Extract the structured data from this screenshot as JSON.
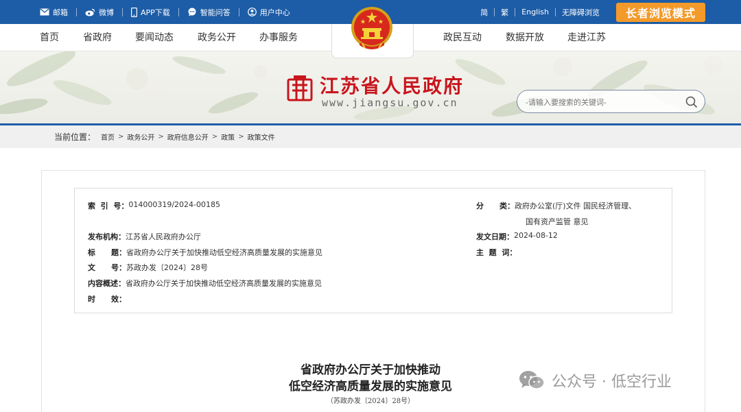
{
  "topbar": {
    "left_items": [
      {
        "icon": "mail-icon",
        "label": "邮箱"
      },
      {
        "icon": "weibo-icon",
        "label": "微博"
      },
      {
        "icon": "phone-icon",
        "label": "APP下载"
      },
      {
        "icon": "chat-icon",
        "label": "智能问答"
      },
      {
        "icon": "user-icon",
        "label": "用户中心"
      }
    ],
    "right_items": [
      "简",
      "繁",
      "English",
      "无障碍浏览"
    ],
    "elder_mode": "长者浏览模式"
  },
  "nav": {
    "left": [
      "首页",
      "省政府",
      "要闻动态",
      "政务公开",
      "办事服务"
    ],
    "right": [
      "政民互动",
      "数据开放",
      "走进江苏"
    ]
  },
  "banner": {
    "site_name": "江苏省人民政府",
    "site_url": "www.jiangsu.gov.cn",
    "search_placeholder": "-请输入要搜索的关键词-"
  },
  "breadcrumb": {
    "lead": "当前位置：",
    "items": [
      "首页",
      "政务公开",
      "政府信息公开",
      "政策",
      "政策文件"
    ]
  },
  "meta": {
    "index_label": "索  引  号：",
    "index_value": "014000319/2024-00185",
    "category_label": "分      类：",
    "category_value_1": "政府办公室(厅)文件 国民经济管理、",
    "category_value_2": "国有资产监管 意见",
    "publisher_label": "发布机构：",
    "publisher_value": "江苏省人民政府办公厅",
    "date_label": "发文日期：",
    "date_value": "2024-08-12",
    "title_label": "标      题：",
    "title_value": "省政府办公厅关于加快推动低空经济高质量发展的实施意见",
    "subject_label": "主  题  词：",
    "subject_value": "",
    "docno_label": "文      号：",
    "docno_value": "苏政办发〔2024〕28号",
    "summary_label": "内容概述：",
    "summary_value": "省政府办公厅关于加快推动低空经济高质量发展的实施意见",
    "validity_label": "时      效：",
    "validity_value": ""
  },
  "document": {
    "title_line1": "省政府办公厅关于加快推动",
    "title_line2": "低空经济高质量发展的实施意见",
    "doc_number": "（苏政办发〔2024〕28号）"
  },
  "watermark": {
    "text": "公众号 · 低空行业"
  },
  "colors": {
    "primary_blue": "#1d5ca6",
    "elder_orange": "#f39a2a",
    "title_red": "#c8161d"
  }
}
